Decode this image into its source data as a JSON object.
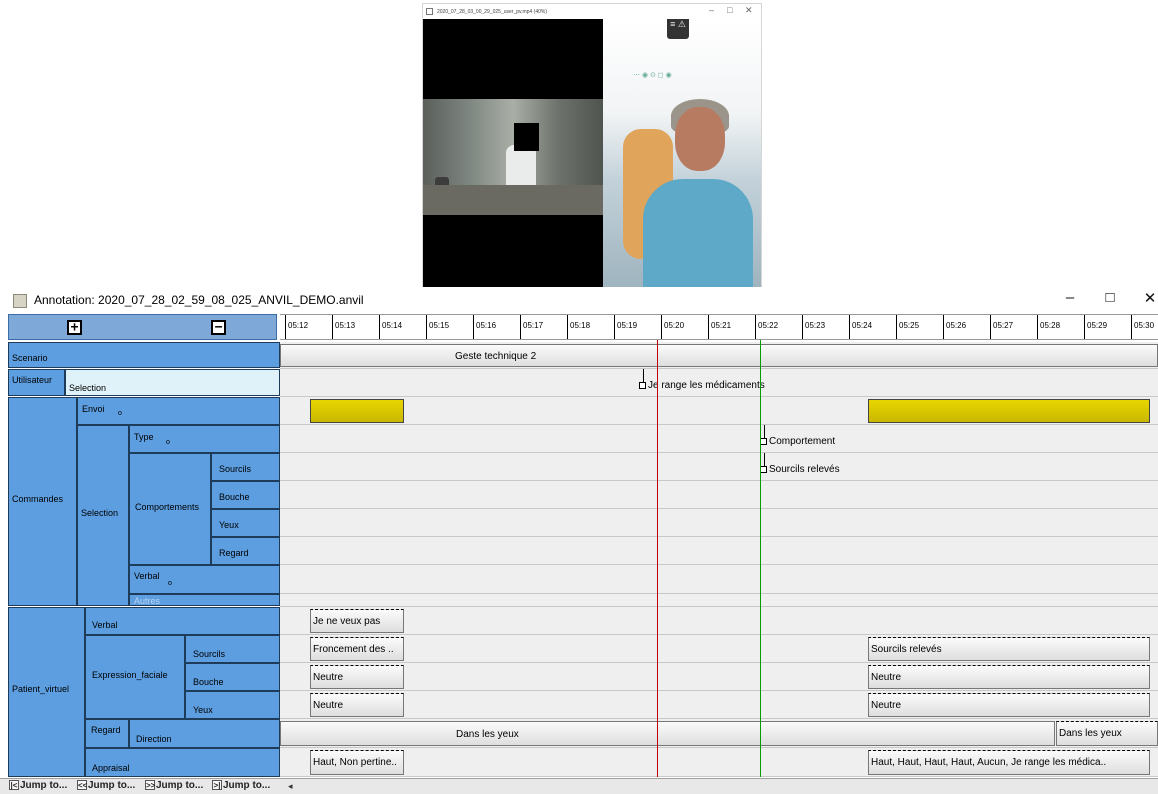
{
  "video": {
    "title": "2020_07_28_03_00_29_025_user_pv.mp4 (40%)",
    "minimize": "–",
    "restore": "□",
    "close": "✕",
    "hud_top": "≡\n⚠",
    "hud_dots": "⋯ ◉ ⊙ ◻ ◉"
  },
  "window": {
    "title": "Annotation: 2020_07_28_02_59_08_025_ANVIL_DEMO.anvil",
    "minimize": "–",
    "maximize": "□",
    "close": "✕"
  },
  "header": {
    "expand": "+",
    "collapse": "−"
  },
  "ticks": [
    "05:12",
    "05:13",
    "05:14",
    "05:15",
    "05:16",
    "05:17",
    "05:18",
    "05:19",
    "05:20",
    "05:21",
    "05:22",
    "05:23",
    "05:24",
    "05:25",
    "05:26",
    "05:27",
    "05:28",
    "05:29",
    "05:30"
  ],
  "tree": {
    "scenario": "Scenario",
    "utilisateur": "Utilisateur",
    "utilisateur_selection": "Selection",
    "commandes": "Commandes",
    "envoi": "Envoi",
    "envoi_o": "o",
    "selection": "Selection",
    "type": "Type",
    "type_o": "o",
    "comportements": "Comportements",
    "sourcils": "Sourcils",
    "bouche": "Bouche",
    "yeux": "Yeux",
    "regard": "Regard",
    "verbal": "Verbal",
    "verbal_o": "o",
    "autres": "Autres",
    "patient_virtuel": "Patient_virtuel",
    "pv_verbal": "Verbal",
    "expression_faciale": "Expression_faciale",
    "ef_sourcils": "Sourcils",
    "ef_bouche": "Bouche",
    "ef_yeux": "Yeux",
    "pv_regard": "Regard",
    "direction": "Direction",
    "appraisal": "Appraisal"
  },
  "annotations": {
    "scenario": "Geste technique 2",
    "utilisateur_selection": "Je range les médicaments",
    "type": "Comportement",
    "sourcils": "Sourcils relevés",
    "pv_verbal": "Je ne veux pas",
    "ef_sourcils_1": "Froncement des ..",
    "ef_sourcils_2": "Sourcils relevés",
    "ef_bouche_1": "Neutre",
    "ef_bouche_2": "Neutre",
    "ef_yeux_1": "Neutre",
    "ef_yeux_2": "Neutre",
    "direction_1": "Dans les yeux",
    "direction_2": "Dans les yeux",
    "appraisal_1": "Haut, Non pertine..",
    "appraisal_2": "Haut, Haut, Haut, Haut, Aucun, Je range les médica.."
  },
  "bottom": {
    "jump1": "Jump to...",
    "jump2": "Jump to...",
    "jump3": "Jump to...",
    "jump4": "Jump to...",
    "icon1": "|<",
    "icon2": "<<",
    "icon3": ">>",
    "icon4": ">|",
    "scroll": "◂"
  },
  "colors": {
    "tree_node": "#5d9ee0",
    "tree_light": "#dff2fa",
    "track_bg": "#efefef",
    "envoi_fill": "#e8d600",
    "red_cursor": "#c00000",
    "green_cursor": "#00a000"
  }
}
